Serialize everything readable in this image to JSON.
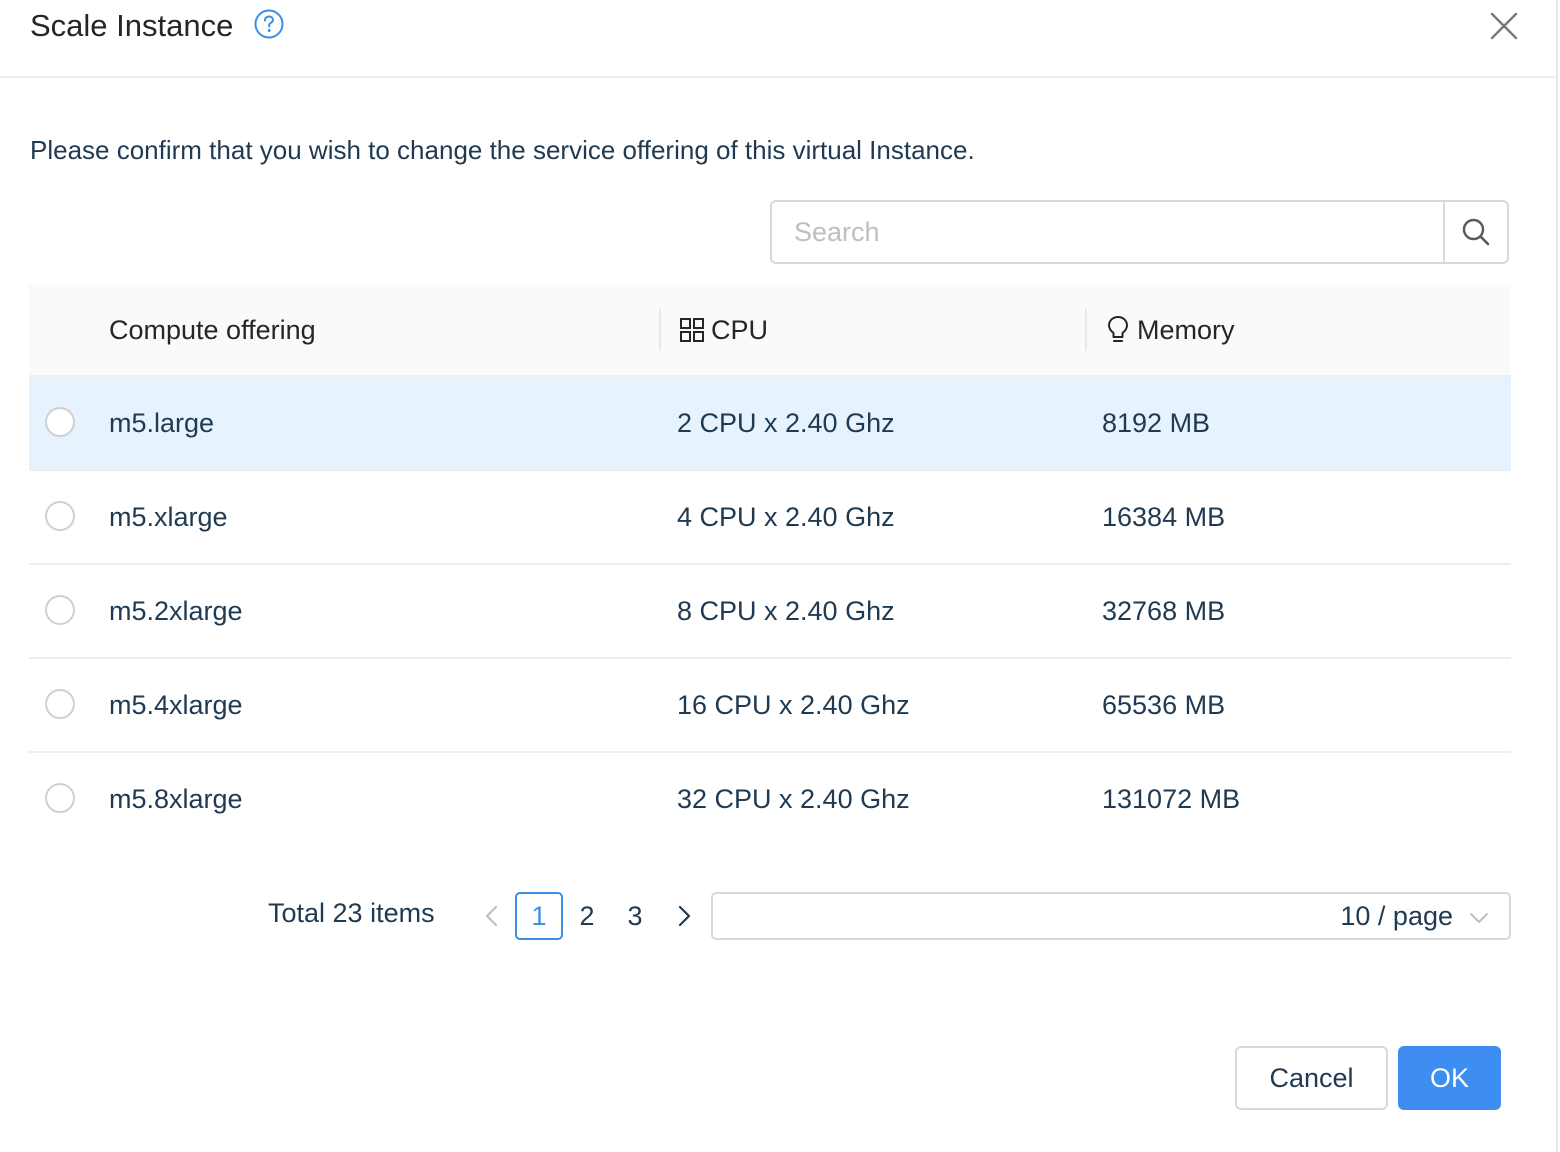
{
  "dialog": {
    "title": "Scale Instance",
    "message": "Please confirm that you wish to change the service offering of this virtual Instance."
  },
  "search": {
    "placeholder": "Search",
    "value": ""
  },
  "table": {
    "columns": {
      "name": "Compute offering",
      "cpu": "CPU",
      "memory": "Memory"
    },
    "rows": [
      {
        "name": "m5.large",
        "cpu": "2 CPU x 2.40 Ghz",
        "memory": "8192 MB",
        "selected": false
      },
      {
        "name": "m5.xlarge",
        "cpu": "4 CPU x 2.40 Ghz",
        "memory": "16384 MB",
        "selected": false
      },
      {
        "name": "m5.2xlarge",
        "cpu": "8 CPU x 2.40 Ghz",
        "memory": "32768 MB",
        "selected": false
      },
      {
        "name": "m5.4xlarge",
        "cpu": "16 CPU x 2.40 Ghz",
        "memory": "65536 MB",
        "selected": false
      },
      {
        "name": "m5.8xlarge",
        "cpu": "32 CPU x 2.40 Ghz",
        "memory": "131072 MB",
        "selected": false
      }
    ]
  },
  "pagination": {
    "total": "Total 23 items",
    "pages": [
      "1",
      "2",
      "3"
    ],
    "current": "1",
    "page_size": "10 / page"
  },
  "footer": {
    "cancel_label": "Cancel",
    "ok_label": "OK"
  },
  "colors": {
    "primary": "#3d8ef0",
    "row_highlight": "#e6f2fd",
    "text": "#1f3a52"
  },
  "icons": {
    "help": "question-circle-icon",
    "close": "close-icon",
    "search": "search-icon",
    "cpu": "appstore-icon",
    "memory": "bulb-icon",
    "prev": "chevron-left-icon",
    "next": "chevron-right-icon",
    "dropdown": "chevron-down-icon"
  }
}
